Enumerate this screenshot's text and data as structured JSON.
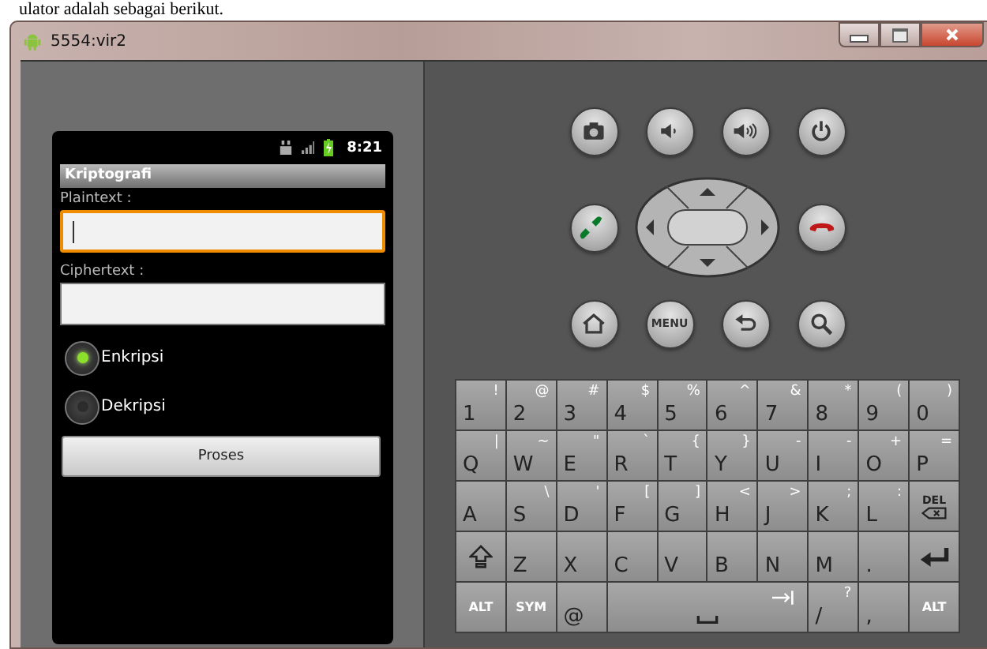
{
  "document_text": "ulator adalah sebagai berikut.",
  "window": {
    "title": "5554:vir2"
  },
  "phone": {
    "status_time": "8:21",
    "app_title": "Kriptografi",
    "fields": [
      {
        "label": "Plaintext :",
        "focused": true
      },
      {
        "label": "Ciphertext :",
        "focused": false
      }
    ],
    "radios": [
      {
        "label": "Enkripsi",
        "selected": true
      },
      {
        "label": "Dekripsi",
        "selected": false
      }
    ],
    "button": "Proses"
  },
  "hardware_buttons": [
    {
      "kind": "camera"
    },
    {
      "kind": "volume-down"
    },
    {
      "kind": "volume-up"
    },
    {
      "kind": "power"
    },
    {
      "kind": "call"
    },
    {
      "kind": "dpad"
    },
    {
      "kind": "end-call"
    },
    {
      "kind": "home"
    },
    {
      "kind": "menu",
      "label": "MENU"
    },
    {
      "kind": "back"
    },
    {
      "kind": "search"
    }
  ],
  "keyboard": [
    [
      {
        "kind": "char",
        "main": "1",
        "alt": "!"
      },
      {
        "kind": "char",
        "main": "2",
        "alt": "@"
      },
      {
        "kind": "char",
        "main": "3",
        "alt": "#"
      },
      {
        "kind": "char",
        "main": "4",
        "alt": "$"
      },
      {
        "kind": "char",
        "main": "5",
        "alt": "%"
      },
      {
        "kind": "char",
        "main": "6",
        "alt": "^"
      },
      {
        "kind": "char",
        "main": "7",
        "alt": "&"
      },
      {
        "kind": "char",
        "main": "8",
        "alt": "*"
      },
      {
        "kind": "char",
        "main": "9",
        "alt": "("
      },
      {
        "kind": "char",
        "main": "0",
        "alt": ")"
      }
    ],
    [
      {
        "kind": "char",
        "main": "Q",
        "alt": "|"
      },
      {
        "kind": "char",
        "main": "W",
        "alt": "~"
      },
      {
        "kind": "char",
        "main": "E",
        "alt": "\""
      },
      {
        "kind": "char",
        "main": "R",
        "alt": "`"
      },
      {
        "kind": "char",
        "main": "T",
        "alt": "{"
      },
      {
        "kind": "char",
        "main": "Y",
        "alt": "}"
      },
      {
        "kind": "char",
        "main": "U",
        "alt": "-"
      },
      {
        "kind": "char",
        "main": "I",
        "alt": "-"
      },
      {
        "kind": "char",
        "main": "O",
        "alt": "+"
      },
      {
        "kind": "char",
        "main": "P",
        "alt": "="
      }
    ],
    [
      {
        "kind": "char",
        "main": "A"
      },
      {
        "kind": "char",
        "main": "S",
        "alt": "\\"
      },
      {
        "kind": "char",
        "main": "D",
        "alt": "'"
      },
      {
        "kind": "char",
        "main": "F",
        "alt": "["
      },
      {
        "kind": "char",
        "main": "G",
        "alt": "]"
      },
      {
        "kind": "char",
        "main": "H",
        "alt": "<"
      },
      {
        "kind": "char",
        "main": "J",
        "alt": ">"
      },
      {
        "kind": "char",
        "main": "K",
        "alt": ";"
      },
      {
        "kind": "char",
        "main": "L",
        "alt": ":"
      },
      {
        "kind": "del",
        "main": "DEL"
      }
    ],
    [
      {
        "kind": "shift"
      },
      {
        "kind": "char",
        "main": "Z"
      },
      {
        "kind": "char",
        "main": "X"
      },
      {
        "kind": "char",
        "main": "C"
      },
      {
        "kind": "char",
        "main": "V"
      },
      {
        "kind": "char",
        "main": "B"
      },
      {
        "kind": "char",
        "main": "N"
      },
      {
        "kind": "char",
        "main": "M"
      },
      {
        "kind": "char",
        "main": "."
      },
      {
        "kind": "enter"
      }
    ],
    [
      {
        "kind": "mod",
        "main": "ALT"
      },
      {
        "kind": "mod",
        "main": "SYM"
      },
      {
        "kind": "char",
        "main": "@"
      },
      {
        "kind": "space"
      },
      {
        "kind": "char",
        "main": "/",
        "alt": "?"
      },
      {
        "kind": "char",
        "main": ","
      },
      {
        "kind": "mod",
        "main": "ALT"
      }
    ]
  ]
}
